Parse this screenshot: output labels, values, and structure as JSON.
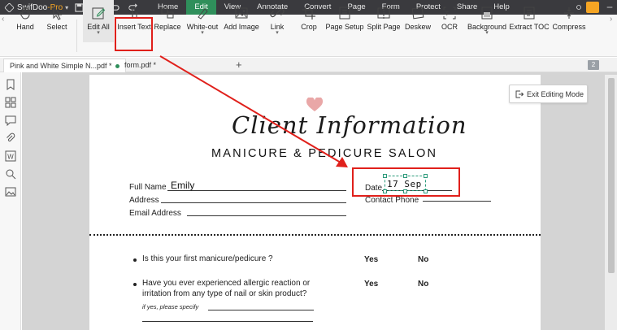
{
  "app": {
    "name": "SwifDoo",
    "edition": "Pro",
    "menus": [
      "Home",
      "Edit",
      "View",
      "Annotate",
      "Convert",
      "Page",
      "Form",
      "Protect",
      "Share",
      "Help"
    ],
    "active_menu": "Edit"
  },
  "toolbar": {
    "hand": "Hand",
    "select": "Select",
    "edit_all": "Edit All",
    "insert_text": "Insert Text",
    "replace": "Replace",
    "white_out": "White-out",
    "add_image": "Add Image",
    "link": "Link",
    "crop": "Crop",
    "page_setup": "Page Setup",
    "split_page": "Split Page",
    "deskew": "Deskew",
    "ocr": "OCR",
    "background": "Background",
    "extract_toc": "Extract TOC",
    "compress": "Compress"
  },
  "tabs": [
    {
      "label": "Pink and White Simple N...pdf *",
      "active": true
    },
    {
      "label": "form.pdf *",
      "active": false
    }
  ],
  "page_count": "2",
  "canvas": {
    "exit_editing": "Exit Editing Mode"
  },
  "document": {
    "title": "Client Information",
    "subtitle": "MANICURE & PEDICURE SALON",
    "fields": {
      "full_name_label": "Full Name",
      "full_name_value": "Emily",
      "address_label": "Address",
      "email_label": "Email Address",
      "date_label": "Date",
      "date_value": "17 Sep",
      "contact_phone_label": "Contact Phone"
    },
    "questions": [
      {
        "text": "Is this your first manicure/pedicure ?",
        "yes": "Yes",
        "no": "No"
      },
      {
        "text_line1": "Have you ever experienced allergic reaction or",
        "text_line2": "irritation from any type of nail or skin product?",
        "yes": "Yes",
        "no": "No",
        "note": "if yes, please specify"
      }
    ]
  },
  "colors": {
    "accent": "#2f8f5b",
    "highlight": "#e0201b",
    "brand_pro": "#f5a524"
  }
}
